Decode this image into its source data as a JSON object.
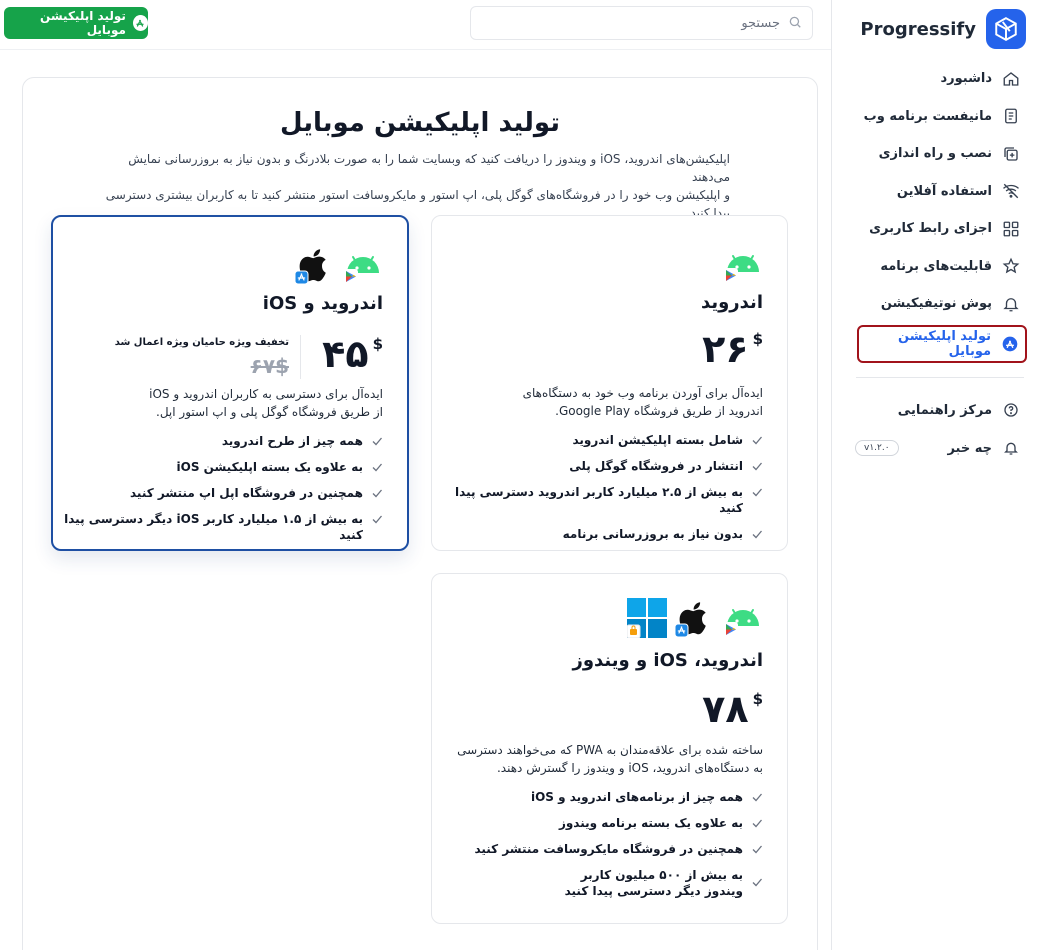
{
  "brand": {
    "name": "Progressify",
    "accent": "#2563eb",
    "green": "#16a34a"
  },
  "topbar": {
    "search_placeholder": "جستجو",
    "cta_label": "تولید اپلیکیشن موبایل"
  },
  "sidebar": {
    "items": [
      {
        "label": "داشبورد",
        "icon": "home-icon"
      },
      {
        "label": "مانیفست برنامه وب",
        "icon": "document-icon"
      },
      {
        "label": "نصب و راه اندازی",
        "icon": "install-icon"
      },
      {
        "label": "استفاده آفلاین",
        "icon": "wifi-off-icon"
      },
      {
        "label": "اجزای رابط کاربری",
        "icon": "grid-icon"
      },
      {
        "label": "قابلیت‌های برنامه",
        "icon": "star-icon"
      },
      {
        "label": "پوش نوتیفیکیشن",
        "icon": "bell-icon"
      },
      {
        "label": "تولید اپلیکیشن موبایل",
        "icon": "app-store-icon",
        "active": true
      }
    ],
    "secondary": [
      {
        "label": "مرکز راهنمایی",
        "icon": "help-icon"
      },
      {
        "label": "چه خبر",
        "icon": "bell-icon",
        "badge": "v۱.۲.۰"
      }
    ]
  },
  "main": {
    "title": "تولید اپلیکیشن موبایل",
    "intro_line1": "اپلیکیشن‌های اندروید، iOS و ویندوز را دریافت کنید که وبسایت شما را به صورت بلادرنگ و بدون نیاز به بروزرسانی نمایش می‌دهند",
    "intro_line2": "و اپلیکیشن وب خود را در فروشگاه‌های گوگل پلی، اپ استور و مایکروسافت استور منتشر کنید تا به کاربران بیشتری دسترسی پیدا کنید."
  },
  "plans": {
    "android": {
      "title": "اندروید",
      "currency": "$",
      "price": "۲۶",
      "desc_line1": "ایده‌آل برای آوردن برنامه وب خود به دستگاه‌های",
      "desc_line2": "اندروید از طریق فروشگاه Google Play.",
      "features": [
        "شامل بسته اپلیکیشن اندروید",
        "انتشار در فروشگاه گوگل پلی",
        "به بیش از ۲.۵ میلیارد کاربر اندروید دسترسی پیدا کنید",
        "بدون نیاز به بروزرسانی برنامه"
      ]
    },
    "android_ios": {
      "title": "اندروید و iOS",
      "currency": "$",
      "price": "۴۵",
      "old_price": "۶۷$",
      "discount_note": "تخفیف ویژه حامیان ویژه اعمال شد",
      "desc_line1": "ایده‌آل برای دسترسی به کاربران اندروید و iOS",
      "desc_line2": "از طریق فروشگاه گوگل پلی و اپ استور اپل.",
      "features": [
        "همه چیز از طرح اندروید",
        "به علاوه یک بسته اپلیکیشن iOS",
        "همچنین در فروشگاه اپل اپ منتشر کنید",
        "به بیش از ۱.۵ میلیارد کاربر iOS دیگر دسترسی پیدا کنید"
      ]
    },
    "all": {
      "title": "اندروید، iOS و ویندوز",
      "currency": "$",
      "price": "۷۸",
      "desc_line1": "ساخته شده برای علاقه‌مندان به PWA که می‌خواهند دسترسی",
      "desc_line2": "به دستگاه‌های اندروید، iOS و ویندوز را گسترش دهند.",
      "features": [
        "همه چیز از برنامه‌های اندروید و iOS",
        "به علاوه یک بسته برنامه ویندوز",
        "همچنین در فروشگاه مایکروسافت منتشر کنید"
      ],
      "last_feature_line1": "به بیش از ۵۰۰ میلیون کاربر",
      "last_feature_line2": "ویندوز دیگر دسترسی پیدا کنید"
    }
  }
}
